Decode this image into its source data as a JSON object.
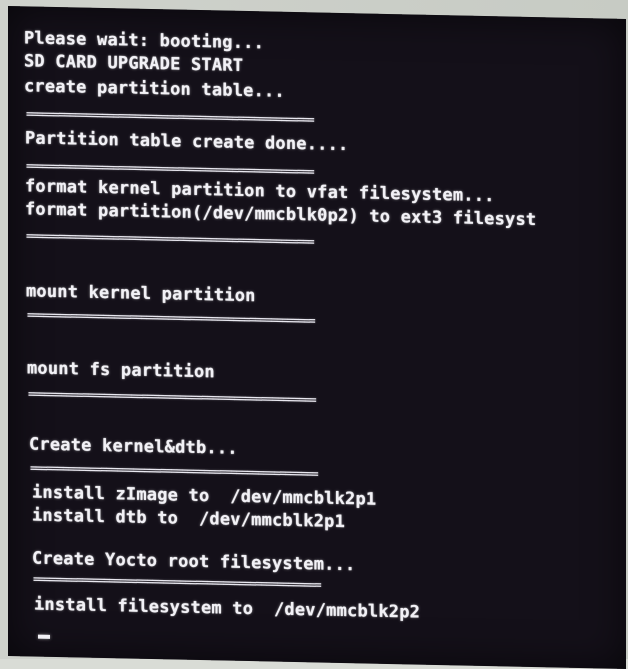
{
  "console": {
    "lines": [
      "Please wait: booting...",
      "SD CARD UPGRADE START",
      "create partition table...",
      "Partition table create done....",
      "format kernel partition to vfat filesystem...",
      "format partition(/dev/mmcblk0p2) to ext3 filesyst",
      "mount kernel partition",
      "mount fs partition",
      "Create kernel&dtb...",
      "install zImage to  /dev/mmcblk2p1",
      "install dtb to  /dev/mmcblk2p1",
      "Create Yocto root filesystem...",
      "install filesystem to  /dev/mmcblk2p2"
    ],
    "separator": "====================================================="
  }
}
